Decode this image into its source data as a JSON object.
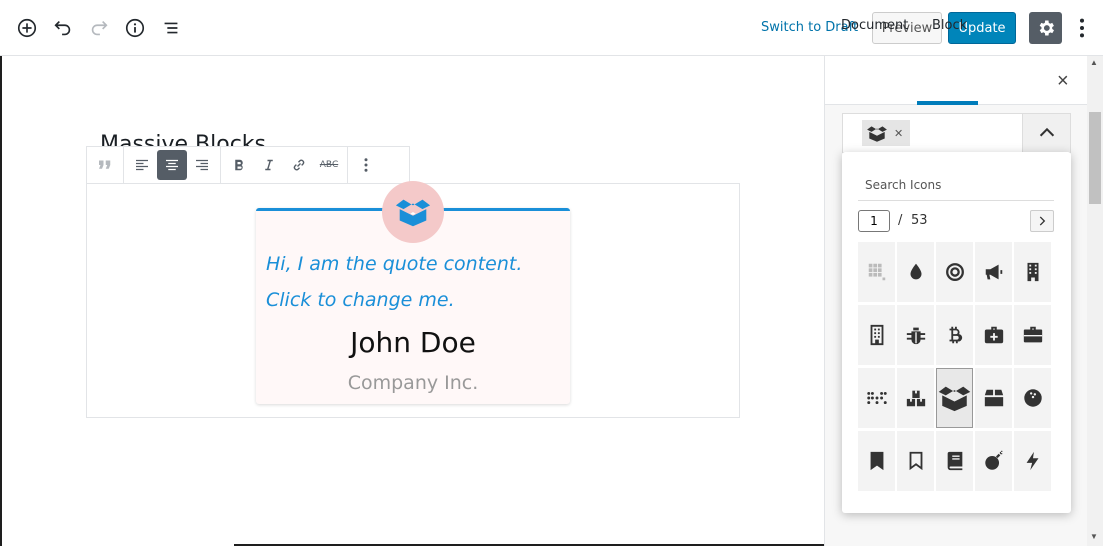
{
  "topbar": {
    "switch_draft": "Switch to Draft",
    "preview": "Preview",
    "update": "Update",
    "icons": [
      "add-block-icon",
      "undo-icon",
      "redo-icon",
      "info-icon",
      "outline-icon",
      "gear-icon",
      "more-vertical-icon"
    ]
  },
  "editor": {
    "block_title": "Massive Blocks",
    "toolbar": {
      "abbr_label": "ABC"
    },
    "quote": {
      "content": "Hi, I am the quote content. Click to change me.",
      "author": "John Doe",
      "company": "Company Inc."
    }
  },
  "sidebar": {
    "tabs": [
      "Document",
      "Block"
    ],
    "active_tab": "Block",
    "icon_picker": {
      "search_placeholder": "Search Icons",
      "page": "1",
      "separator": "/",
      "total_pages": "53",
      "selected_icon": "box-open-icon",
      "icons": [
        "grid-icon",
        "tint-icon",
        "bullseye-icon",
        "bullhorn-icon",
        "building-icon",
        "building-outline-icon",
        "bug-icon",
        "bitcoin-icon",
        "first-aid-kit-icon",
        "briefcase-icon",
        "braille-icon",
        "boxes-icon",
        "box-open-icon",
        "box-icon",
        "bowling-ball-icon",
        "bookmark-icon",
        "bookmark-outline-icon",
        "book-icon",
        "bomb-icon",
        "bolt-icon"
      ]
    }
  },
  "colors": {
    "accent": "#0085ba",
    "link": "#0073aa",
    "quote_blue": "#1a8fd8",
    "badge_pink": "#f4c9c9",
    "card_bg": "#fff8f8"
  }
}
